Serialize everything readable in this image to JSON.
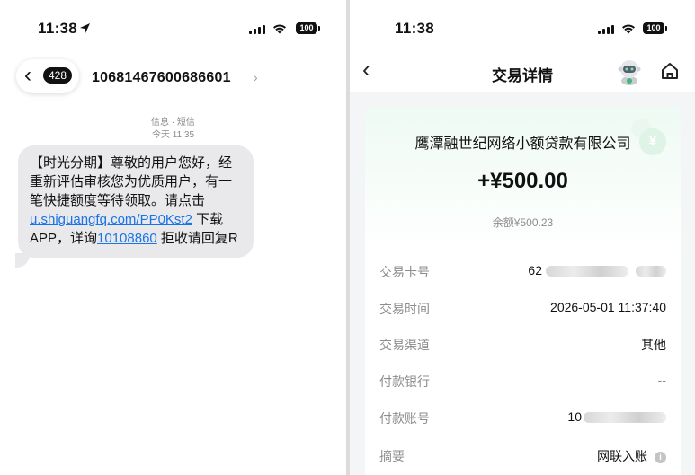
{
  "left_phone": {
    "status": {
      "time": "11:38",
      "battery": "100"
    },
    "header": {
      "unread_count": "428",
      "sender": "10681467600686601"
    },
    "meta": {
      "channel": "信息 · 短信",
      "timestamp": "今天 11:35"
    },
    "message": {
      "part1": "【时光分期】尊敬的用户您好，经重新评估审核您为优质用户，有一笔快捷额度等待领取。请点击 ",
      "link": "u.shiguangfq.com/PP0Kst2",
      "part2": " 下载 APP，详询",
      "phone": "10108860",
      "part3": " 拒收请回复R"
    }
  },
  "right_phone": {
    "status": {
      "time": "11:38",
      "battery": "100"
    },
    "nav": {
      "title": "交易详情"
    },
    "card": {
      "company": "鹰潭融世纪网络小额贷款有限公司",
      "amount": "+¥500.00",
      "balance": "余额¥500.23",
      "yuan_symbol": "¥",
      "rows": [
        {
          "label": "交易卡号",
          "value": "62"
        },
        {
          "label": "交易时间",
          "value": "2026-05-01 11:37:40"
        },
        {
          "label": "交易渠道",
          "value": "其他"
        },
        {
          "label": "付款银行",
          "value": "--"
        },
        {
          "label": "付款账号",
          "value": "10"
        },
        {
          "label": "摘要",
          "value": "网联入账"
        }
      ]
    }
  },
  "colors": {
    "link": "#1a73e8",
    "bubble": "#e9e9eb",
    "card_tint": "#eefaf3"
  }
}
